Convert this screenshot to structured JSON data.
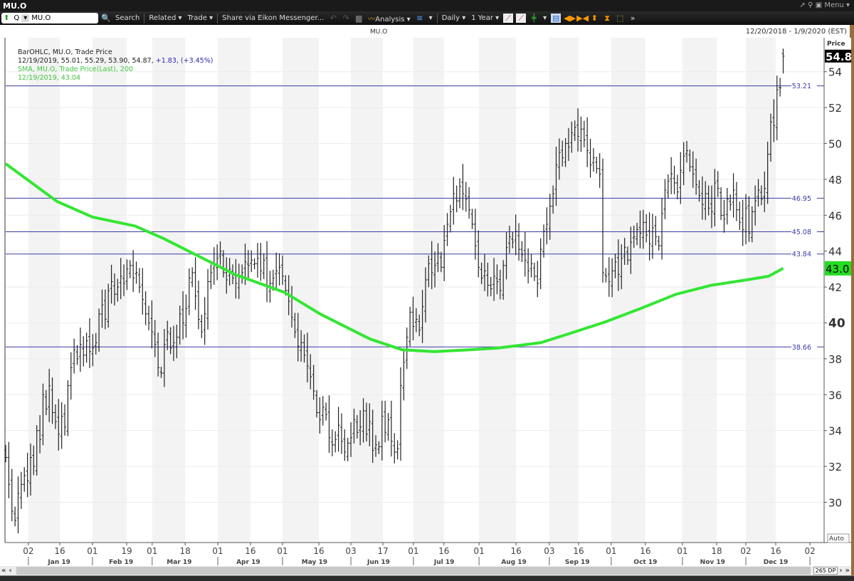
{
  "window": {
    "title": "MU.O",
    "controls": [
      "pop-out",
      "pin",
      "Menu"
    ]
  },
  "toolbar": {
    "ric_prefix": "Q",
    "ric_value": "MU.O",
    "search": "Search",
    "related": "Related",
    "trade": "Trade",
    "share": "Share via Eikon Messenger...",
    "analysis": "Analysis",
    "interval": "Daily",
    "range": "1 Year"
  },
  "subheader": {
    "title": "MU.O",
    "date_range": "12/20/2018 - 1/9/2020 (EST)"
  },
  "legend": {
    "line1": "BarOHLC, MU.O, Trade Price",
    "line2_values": "12/19/2019, 55.01, 55.29, 53.90, 54.87,",
    "line2_change": " +1.83, (+3.45%)",
    "line3": "SMA, MU.O, Trade Price(Last),  200",
    "line4": "12/19/2019, 43.04"
  },
  "axis": {
    "title": "Price",
    "last_price": "54.8",
    "sma_last": "43.0",
    "auto": "Auto"
  },
  "scrollbar": {
    "first": "«",
    "prev": "‹",
    "count": "265 DP",
    "next": "›",
    "last": "»"
  },
  "colors": {
    "sma": "#33e633",
    "hline": "#3a3aa8",
    "bars": "#222222",
    "band": "#f3f3f3"
  },
  "chart_data": {
    "type": "ohlc",
    "symbol": "MU.O",
    "ylim": [
      28.2,
      56.1
    ],
    "yticks": [
      30,
      32,
      34,
      36,
      38,
      40,
      42,
      44,
      46,
      48,
      50,
      52,
      54
    ],
    "hlines": [
      53.21,
      46.95,
      45.08,
      43.84,
      38.66
    ],
    "xticks": [
      {
        "label": "02",
        "bar": 7.3
      },
      {
        "label": "16",
        "bar": 17.4
      },
      {
        "label": "01",
        "bar": 27.9
      },
      {
        "label": "19",
        "bar": 38.9
      },
      {
        "label": "01",
        "bar": 47.1
      },
      {
        "label": "18",
        "bar": 57.7
      },
      {
        "label": "01",
        "bar": 68.2
      },
      {
        "label": "16",
        "bar": 78.7
      },
      {
        "label": "01",
        "bar": 89
      },
      {
        "label": "16",
        "bar": 100.7
      },
      {
        "label": "03",
        "bar": 111
      },
      {
        "label": "17",
        "bar": 121.3
      },
      {
        "label": "01",
        "bar": 131.1
      },
      {
        "label": "16",
        "bar": 140.9
      },
      {
        "label": "01",
        "bar": 152.2
      },
      {
        "label": "16",
        "bar": 164.1
      },
      {
        "label": "03",
        "bar": 174.8
      },
      {
        "label": "16",
        "bar": 184.2
      },
      {
        "label": "01",
        "bar": 194.7
      },
      {
        "label": "16",
        "bar": 205.7
      },
      {
        "label": "01",
        "bar": 217.6
      },
      {
        "label": "18",
        "bar": 228.6
      },
      {
        "label": "02",
        "bar": 238
      },
      {
        "label": "16",
        "bar": 247.6
      },
      {
        "label": "02",
        "bar": 258.6
      }
    ],
    "months": [
      {
        "label": "Jan 19",
        "bar": 17.2
      },
      {
        "label": "Feb 19",
        "bar": 37.1
      },
      {
        "label": "Mar 19",
        "bar": 55.8
      },
      {
        "label": "Apr 19",
        "bar": 78
      },
      {
        "label": "May 19",
        "bar": 99.3
      },
      {
        "label": "Jun 19",
        "bar": 119.9
      },
      {
        "label": "Jul 19",
        "bar": 141
      },
      {
        "label": "Aug 19",
        "bar": 163.4
      },
      {
        "label": "Sep 19",
        "bar": 183.8
      },
      {
        "label": "Oct 19",
        "bar": 205.7
      },
      {
        "label": "Nov 19",
        "bar": 227.3
      },
      {
        "label": "Dec 19",
        "bar": 247.6
      }
    ],
    "closes": [
      32.5,
      31,
      29.5,
      29,
      30.5,
      31,
      31.5,
      31.2,
      32.5,
      32,
      34,
      33.5,
      36,
      35.2,
      36.5,
      35,
      34.5,
      33.8,
      34.8,
      34.2,
      36.5,
      37.5,
      38.5,
      38,
      38.8,
      38.2,
      39,
      38.4,
      38.6,
      38.9,
      40.5,
      41,
      40.2,
      41.8,
      42.3,
      41.6,
      42,
      42.6,
      42.2,
      43,
      43.2,
      42.5,
      42.8,
      42,
      41.3,
      40.5,
      40,
      39.5,
      38.8,
      37.5,
      37.2,
      38.8,
      39.5,
      38.6,
      38.9,
      39.2,
      40.5,
      40,
      40.8,
      42.5,
      42.8,
      41.5,
      40.2,
      39.5,
      40.5,
      42.3,
      42.8,
      43.2,
      43.6,
      44,
      42.8,
      42.4,
      43,
      42.5,
      42.2,
      42.6,
      42.8,
      43.4,
      43.2,
      43.5,
      43.3,
      43.6,
      42.9,
      43.5,
      42,
      42.2,
      42.5,
      42.9,
      43.1,
      42.6,
      41.8,
      41.2,
      40.3,
      39.5,
      38.7,
      38.9,
      38.2,
      37.6,
      37,
      36.2,
      35,
      34.6,
      35.3,
      34.9,
      33.6,
      33.2,
      33.5,
      34.3,
      33.4,
      32.8,
      33.3,
      33.6,
      34.6,
      33.9,
      34.2,
      35.1,
      33.8,
      34.5,
      32.9,
      33.2,
      33.1,
      34.8,
      33.9,
      34.6,
      33.4,
      32.8,
      33,
      36.5,
      37.8,
      39.2,
      40.6,
      39.8,
      40.2,
      39.6,
      40.9,
      42.4,
      43.3,
      42.8,
      43.2,
      43.9,
      43.1,
      44.6,
      45.5,
      46.2,
      47.2,
      46.8,
      47.6,
      47.2,
      46.9,
      46.3,
      45.5,
      44.3,
      43.1,
      42.5,
      42.9,
      42.1,
      41.9,
      42.6,
      42.3,
      41.8,
      43.2,
      44.2,
      44.8,
      44.5,
      45.1,
      44.1,
      43.8,
      43.5,
      42.9,
      43.3,
      42.6,
      42.2,
      44.1,
      45.1,
      45.5,
      46.5,
      47.2,
      48.8,
      49.5,
      49.2,
      50,
      49.8,
      50.6,
      50.9,
      50.4,
      50.8,
      50.2,
      49.6,
      48.8,
      49.2,
      48.6,
      48.3,
      42.8,
      42.6,
      42.3,
      42.9,
      43.4,
      42.7,
      43.6,
      44.2,
      43.5,
      44.5,
      44.8,
      45.2,
      45,
      45.6,
      44.9,
      44.4,
      45.3,
      44.8,
      44.3,
      46.1,
      47.4,
      47.9,
      48.3,
      47.8,
      47.3,
      48.5,
      49.3,
      49.6,
      48.7,
      48.3,
      47.7,
      47.1,
      46.6,
      47.2,
      46.4,
      46.2,
      47.8,
      47.5,
      46,
      45.8,
      46.9,
      46.6,
      47.4,
      46.3,
      45.6,
      45.2,
      46.4,
      45,
      46.2,
      46.8,
      47.4,
      46.9,
      47.5,
      49.4,
      51.2,
      51,
      53,
      53.1,
      54.87
    ],
    "last_bar": {
      "date": "12/19/2019",
      "open": 55.01,
      "high": 55.29,
      "low": 53.9,
      "close": 54.87
    },
    "sma200": [
      [
        0,
        48.87
      ],
      [
        16.5,
        46.77
      ],
      [
        27.9,
        45.9
      ],
      [
        41.6,
        45.4
      ],
      [
        50.8,
        44.7
      ],
      [
        61.1,
        43.8
      ],
      [
        73.7,
        42.7
      ],
      [
        89.7,
        41.7
      ],
      [
        101.1,
        40.5
      ],
      [
        117.2,
        39.1
      ],
      [
        127.5,
        38.5
      ],
      [
        137.8,
        38.4
      ],
      [
        149.2,
        38.5
      ],
      [
        158.4,
        38.6
      ],
      [
        172.1,
        38.9
      ],
      [
        181.2,
        39.4
      ],
      [
        192.7,
        40.05
      ],
      [
        204.1,
        40.8
      ],
      [
        215.6,
        41.6
      ],
      [
        227,
        42.1
      ],
      [
        238.4,
        42.4
      ],
      [
        245.3,
        42.6
      ],
      [
        250,
        43.04
      ]
    ]
  }
}
